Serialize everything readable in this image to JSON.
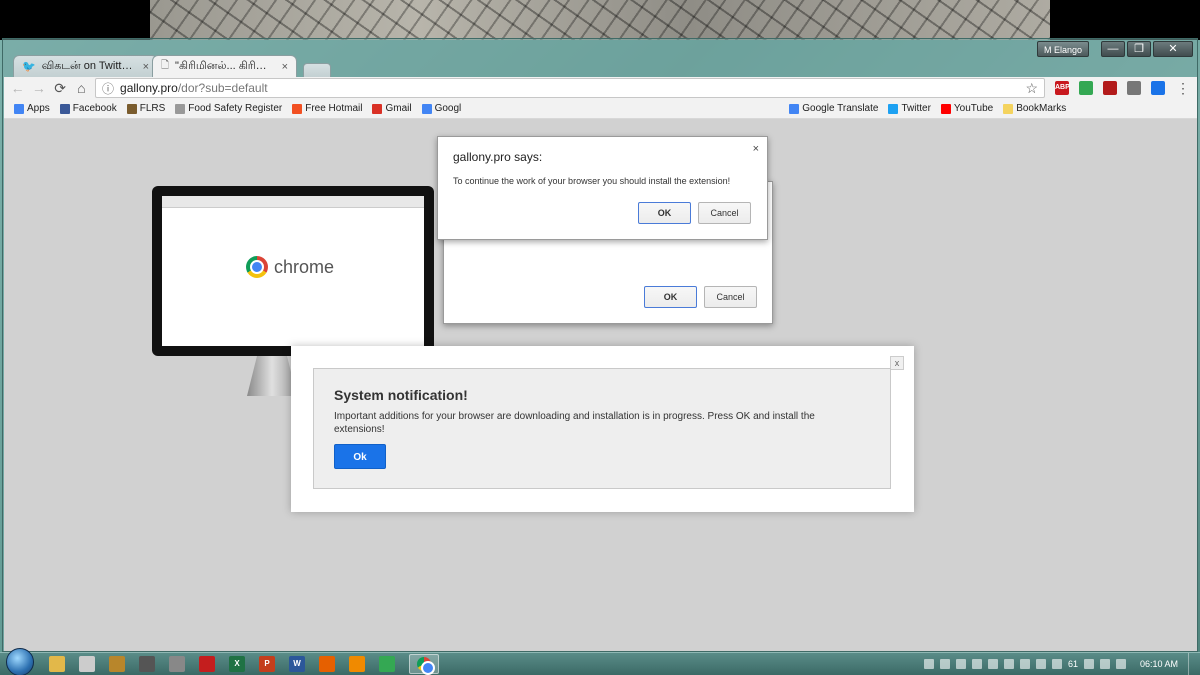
{
  "window": {
    "user_chip": "M Elango",
    "min": "—",
    "max": "❐",
    "close": "✕"
  },
  "tabs": [
    {
      "title": "விகடன் on Twitter: \"",
      "close": "×"
    },
    {
      "title": "\"கிரிமினல்... கிரிமினல்",
      "close": "×"
    }
  ],
  "toolbar": {
    "back": "←",
    "forward": "→",
    "reload": "⟳",
    "home": "⌂",
    "info": "ⓘ",
    "url_host": "gallony.pro",
    "url_path": "/dor?sub=default",
    "star": "☆",
    "menu": "⋮"
  },
  "extensions": [
    {
      "name": "adblock-icon",
      "label": "ABP",
      "color": "#c8181e"
    },
    {
      "name": "extension-icon-1",
      "label": "",
      "color": "#34a853"
    },
    {
      "name": "acrobat-icon",
      "label": "",
      "color": "#b31b1b"
    },
    {
      "name": "extension-icon-2",
      "label": "",
      "color": "#777777"
    },
    {
      "name": "extension-icon-3",
      "label": "",
      "color": "#1a73e8"
    }
  ],
  "bookmarks": [
    {
      "label": "Apps",
      "icon": "apps-grid-icon",
      "color": "#4285f4"
    },
    {
      "label": "Facebook",
      "icon": "facebook-icon",
      "color": "#3b5998"
    },
    {
      "label": "FLRS",
      "icon": "flrs-icon",
      "color": "#7a5c2e"
    },
    {
      "label": "Food Safety Register",
      "icon": "page-icon",
      "color": "#999999"
    },
    {
      "label": "Free Hotmail",
      "icon": "windows-icon",
      "color": "#f25022"
    },
    {
      "label": "Gmail",
      "icon": "gmail-icon",
      "color": "#d93025"
    },
    {
      "label": "Googl",
      "icon": "google-icon",
      "color": "#4285f4"
    },
    {
      "label": "Google Translate",
      "icon": "translate-icon",
      "color": "#4285f4"
    },
    {
      "label": "Twitter",
      "icon": "twitter-icon",
      "color": "#1da1f2"
    },
    {
      "label": "YouTube",
      "icon": "youtube-icon",
      "color": "#ff0000"
    },
    {
      "label": "BookMarks",
      "icon": "folder-icon",
      "color": "#f4d35e"
    }
  ],
  "monitor": {
    "logo_text": "chrome"
  },
  "alert_front": {
    "title": "gallony.pro says:",
    "close": "×",
    "message": "To continue the work of your browser you should install the extension!",
    "ok": "OK",
    "cancel": "Cancel"
  },
  "alert_back": {
    "ok": "OK",
    "cancel": "Cancel"
  },
  "notification": {
    "close": "x",
    "title": "System notification!",
    "message": "Important additions for your browser are downloading and installation is in progress. Press OK and install the extensions!",
    "ok": "Ok"
  },
  "taskbar": {
    "apps": [
      {
        "name": "explorer-icon",
        "label": "",
        "color": "#e2b84a"
      },
      {
        "name": "app-icon-1",
        "label": "",
        "color": "#cccccc"
      },
      {
        "name": "app-icon-2",
        "label": "",
        "color": "#b8862b"
      },
      {
        "name": "app-icon-3",
        "label": "",
        "color": "#555555"
      },
      {
        "name": "printer-icon",
        "label": "",
        "color": "#888888"
      },
      {
        "name": "acrobat-icon",
        "label": "",
        "color": "#c41e1e"
      },
      {
        "name": "excel-icon",
        "label": "X",
        "color": "#1f7244"
      },
      {
        "name": "powerpoint-icon",
        "label": "P",
        "color": "#c43e1c"
      },
      {
        "name": "word-icon",
        "label": "W",
        "color": "#2b579a"
      },
      {
        "name": "firefox-icon",
        "label": "",
        "color": "#e66000"
      },
      {
        "name": "vlc-icon",
        "label": "",
        "color": "#f08a00"
      },
      {
        "name": "chrome-icon",
        "label": "",
        "color": "#34a853"
      }
    ],
    "tray_number": "61",
    "clock": "06:10 AM"
  }
}
